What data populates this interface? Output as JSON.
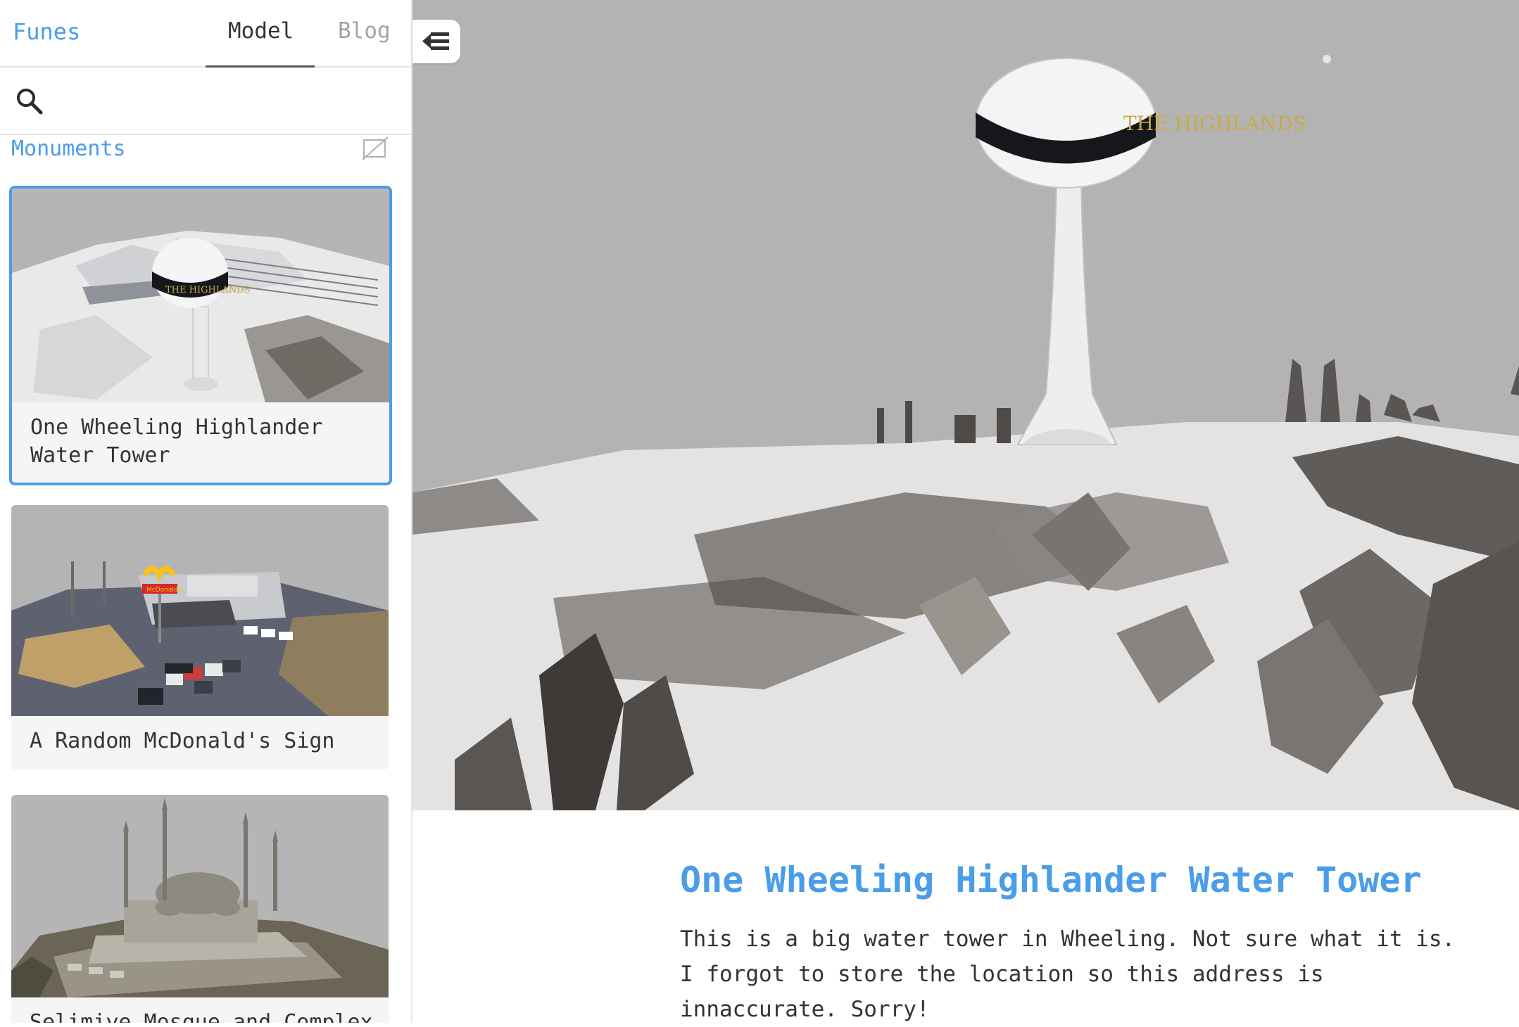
{
  "app": {
    "brand": "Funes",
    "tabs": [
      {
        "label": "Model",
        "active": true
      },
      {
        "label": "Blog",
        "active": false
      }
    ]
  },
  "sidebar": {
    "search_icon": "search-icon",
    "collection": {
      "title": "Monuments",
      "toggle_icon": "hide-icon"
    },
    "models": [
      {
        "label": "One Wheeling Highlander Water Tower",
        "selected": true
      },
      {
        "label": "A Random McDonald's Sign",
        "selected": false
      },
      {
        "label": "Selimiye Mosque and Complex",
        "selected": false
      }
    ]
  },
  "viewer": {
    "collapse_icon": "collapse-sidebar-icon",
    "tower_text": "THE HIGHLANDS"
  },
  "detail": {
    "title": "One Wheeling Highlander Water Tower",
    "description": "This is a big water tower in Wheeling. Not sure what it is. I forgot to store the location so this address is innaccurate. Sorry!"
  },
  "colors": {
    "accent": "#4a9de8",
    "sky": "#b3b3b4"
  }
}
